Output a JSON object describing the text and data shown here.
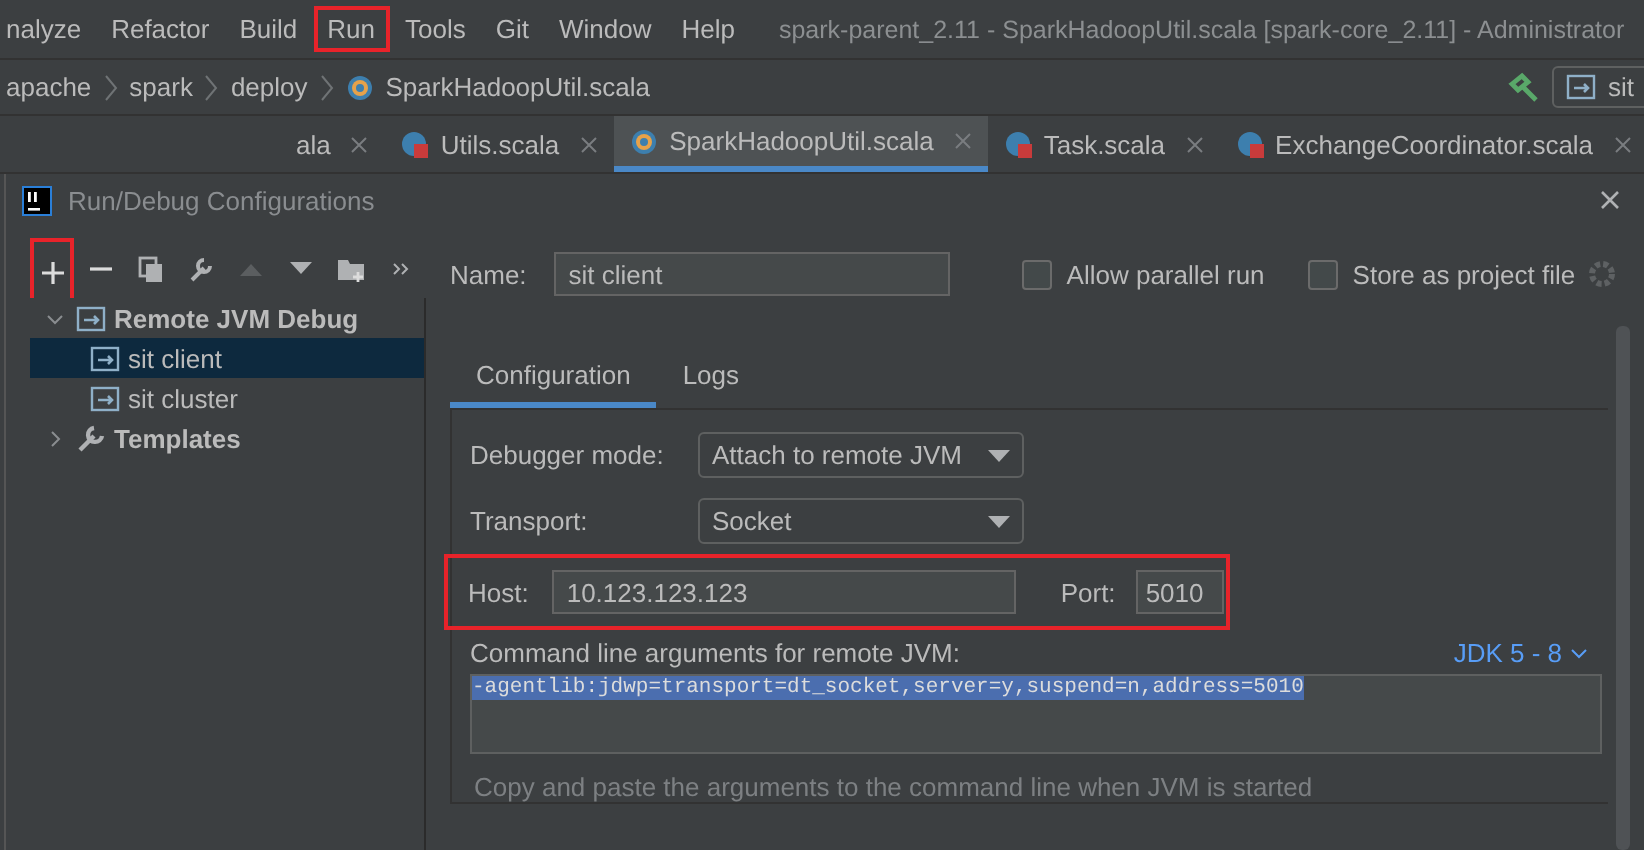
{
  "menu_bar": {
    "items": [
      {
        "label": "nalyze",
        "highlighted": false
      },
      {
        "label": "Refactor",
        "highlighted": false
      },
      {
        "label": "Build",
        "highlighted": false
      },
      {
        "label": "Run",
        "highlighted": true
      },
      {
        "label": "Tools",
        "highlighted": false
      },
      {
        "label": "Git",
        "highlighted": false
      },
      {
        "label": "Window",
        "highlighted": false
      },
      {
        "label": "Help",
        "highlighted": false
      }
    ],
    "title": "spark-parent_2.11 - SparkHadoopUtil.scala [spark-core_2.11] - Administrator"
  },
  "breadcrumbs": [
    "apache",
    "spark",
    "deploy",
    "SparkHadoopUtil.scala"
  ],
  "run_config_button": "sit",
  "editor_tabs": [
    {
      "label": "ala",
      "kind": "plain",
      "selected": false
    },
    {
      "label": "Utils.scala",
      "kind": "object",
      "selected": false
    },
    {
      "label": "SparkHadoopUtil.scala",
      "kind": "class",
      "selected": true
    },
    {
      "label": "Task.scala",
      "kind": "object",
      "selected": false
    },
    {
      "label": "ExchangeCoordinator.scala",
      "kind": "object",
      "selected": false
    }
  ],
  "dialog": {
    "title": "Run/Debug Configurations",
    "toolbar": {
      "add_highlighted": true
    },
    "tree": [
      {
        "label": "Remote JVM Debug",
        "kind": "group",
        "expanded": true,
        "selected": false,
        "children": [
          {
            "label": "sit client",
            "kind": "config",
            "selected": true
          },
          {
            "label": "sit cluster",
            "kind": "config",
            "selected": false
          }
        ]
      },
      {
        "label": "Templates",
        "kind": "templates",
        "expanded": false,
        "selected": false
      }
    ],
    "name": {
      "label": "Name:",
      "value": "sit client"
    },
    "allow_parallel_run": {
      "label": "Allow parallel run",
      "checked": false
    },
    "store_as_project_file": {
      "label": "Store as project file",
      "checked": false
    },
    "tabs": [
      {
        "label": "Configuration",
        "selected": true
      },
      {
        "label": "Logs",
        "selected": false
      }
    ],
    "debugger_mode": {
      "label": "Debugger mode:",
      "value": "Attach to remote JVM"
    },
    "transport": {
      "label": "Transport:",
      "value": "Socket"
    },
    "connection": {
      "highlighted": true,
      "host": {
        "label": "Host:",
        "value": "10.123.123.123"
      },
      "port": {
        "label": "Port:",
        "value": "5010"
      }
    },
    "command_line": {
      "label": "Command line arguments for remote JVM:",
      "jdk": "JDK 5 - 8",
      "value": "-agentlib:jdwp=transport=dt_socket,server=y,suspend=n,address=5010",
      "selected_text": true
    },
    "hint": "Copy and paste the arguments to the command line when JVM is started"
  }
}
